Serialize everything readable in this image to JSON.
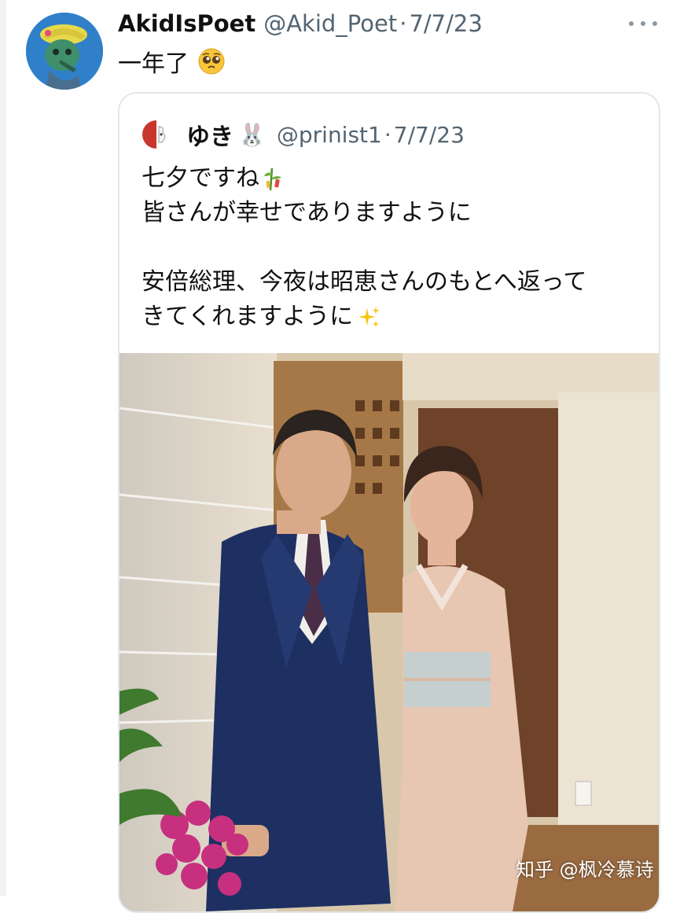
{
  "tweet": {
    "author_name": "AkidIsPoet",
    "author_handle": "@Akid_Poet",
    "separator": "·",
    "date": "7/7/23",
    "text": "一年了",
    "text_emoji": "pleading-face-icon"
  },
  "quoted_tweet": {
    "author_name": "ゆき",
    "name_emoji": "🐰",
    "author_handle": "@prinist1",
    "separator": "·",
    "date": "7/7/23",
    "lines": [
      "七夕ですね",
      "皆さんが幸せでありますように",
      "",
      "安倍総理、今夜は昭恵さんのもとへ返って",
      "きてくれますように"
    ],
    "line1_emoji": "tanabata-tree-icon",
    "line5_emoji": "sparkles-icon"
  },
  "watermark": "知乎 @枫冷慕诗",
  "colors": {
    "secondary_text": "#536471",
    "border": "#e1e8ed",
    "avatar_bg": "#2f80c9"
  }
}
